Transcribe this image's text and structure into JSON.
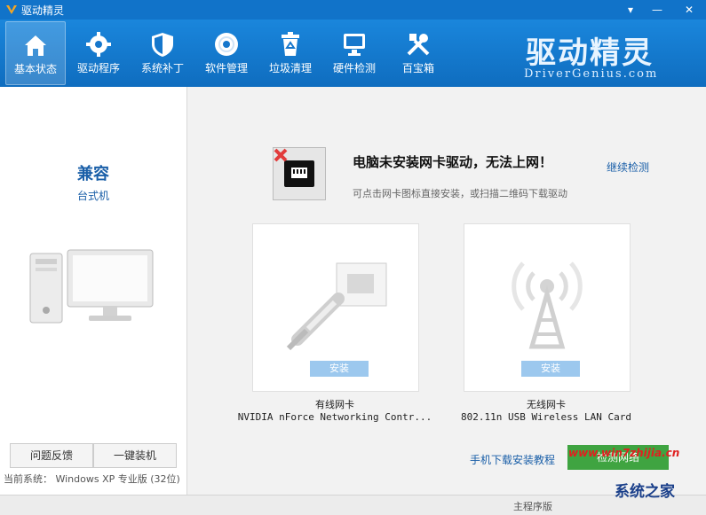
{
  "app": {
    "title": "驱动精灵"
  },
  "nav": [
    {
      "label": "基本状态",
      "icon": "home-icon"
    },
    {
      "label": "驱动程序",
      "icon": "gear-icon"
    },
    {
      "label": "系统补丁",
      "icon": "shield-icon"
    },
    {
      "label": "软件管理",
      "icon": "disc-icon"
    },
    {
      "label": "垃圾清理",
      "icon": "trash-icon"
    },
    {
      "label": "硬件检测",
      "icon": "monitor-icon"
    },
    {
      "label": "百宝箱",
      "icon": "tools-icon"
    }
  ],
  "brand": {
    "cn": "驱动精灵",
    "en": "DriverGenius.com"
  },
  "sidebar": {
    "compat": "兼容",
    "pc_type": "台式机",
    "feedback": "问题反馈",
    "one_click": "一键装机",
    "current_os": "当前系统： Windows XP 专业版 (32位)"
  },
  "alert": {
    "title": "电脑未安装网卡驱动，无法上网！",
    "recheck": "继续检测",
    "subtitle": "可点击网卡图标直接安装，或扫描二维码下载驱动"
  },
  "cards": [
    {
      "install": "安装",
      "name": "有线网卡",
      "device": "NVIDIA nForce Networking Contr..."
    },
    {
      "install": "安装",
      "name": "无线网卡",
      "device": "802.11n USB Wireless LAN Card"
    }
  ],
  "bottom": {
    "mobile": "手机下载安装教程",
    "detect": "检测网络"
  },
  "status": {
    "main_version": "主程序版"
  },
  "watermark": {
    "url": "www.win7zhijia.cn",
    "site": "系统之家"
  },
  "colors": {
    "primary": "#1173c9",
    "link": "#1a5fa8",
    "install": "#9cc8ee",
    "detect": "#3fa441"
  }
}
